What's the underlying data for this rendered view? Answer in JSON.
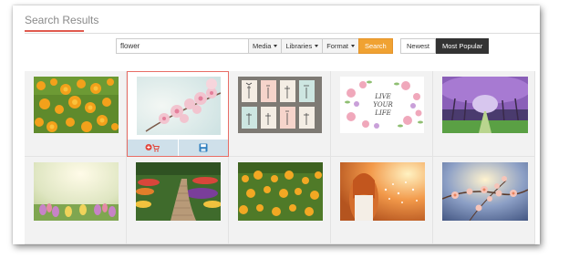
{
  "section": {
    "title": "Search Results"
  },
  "search": {
    "query": "flower",
    "filters": [
      {
        "label": "Media"
      },
      {
        "label": "Libraries"
      },
      {
        "label": "Format"
      }
    ],
    "submit_label": "Search"
  },
  "sort": {
    "options": [
      {
        "label": "Newest",
        "active": false
      },
      {
        "label": "Most Popular",
        "active": true
      }
    ]
  },
  "results": [
    {
      "subject": "orange marigolds"
    },
    {
      "subject": "pink blossom branch",
      "selected": true,
      "actions": [
        "add-to-cart-icon",
        "save-icon"
      ]
    },
    {
      "subject": "botanical sketch cards"
    },
    {
      "subject": "watercolor floral wreath with lettering"
    },
    {
      "subject": "purple tree tunnel"
    },
    {
      "subject": "soft focus tulips"
    },
    {
      "subject": "garden path with flowerbeds"
    },
    {
      "subject": "yellow flower field"
    },
    {
      "subject": "woman with dandelion at sunset"
    },
    {
      "subject": "blossoms in sunlight"
    }
  ],
  "thumb_texts": {
    "live_life": [
      "LIVE",
      "YOUR",
      "LIFE"
    ]
  },
  "colors": {
    "accent_orange": "#f0a232",
    "active_dark": "#333333",
    "title_underline": "#e05a4e",
    "selected_border": "#e86d66",
    "action_bar": "#cfe0ea"
  }
}
